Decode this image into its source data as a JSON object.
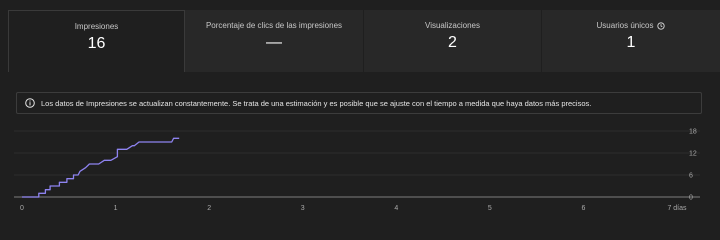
{
  "tabs": [
    {
      "label": "Impresiones",
      "value": "16",
      "active": true
    },
    {
      "label": "Porcentaje de clics de las impresiones",
      "value": "—",
      "active": false
    },
    {
      "label": "Visualizaciones",
      "value": "2",
      "active": false
    },
    {
      "label": "Usuarios únicos",
      "value": "1",
      "active": false,
      "icon": "clock-icon"
    }
  ],
  "banner": {
    "icon": "info-icon",
    "text": "Los datos de Impresiones se actualizan constantemente. Se trata de una estimación y es posible que se ajuste con el tiempo a medida que haya datos más precisos."
  },
  "colors": {
    "background": "#1f1f1f",
    "tab_inactive": "#282828",
    "line": "#8e83f0",
    "grid": "#3a3a3a"
  },
  "chart_data": {
    "type": "line",
    "x_ticks": [
      "0",
      "1",
      "2",
      "3",
      "4",
      "5",
      "6",
      "7 días"
    ],
    "y_ticks": [
      "0",
      "6",
      "12",
      "18"
    ],
    "xlim": [
      0,
      7
    ],
    "ylim": [
      0,
      18
    ],
    "series": [
      {
        "x": [
          0,
          0.18,
          0.18,
          0.25,
          0.25,
          0.3,
          0.3,
          0.4,
          0.4,
          0.48,
          0.48,
          0.55,
          0.55,
          0.6,
          0.62,
          0.68,
          0.72,
          0.78,
          0.82,
          0.88,
          0.95,
          0.95,
          1.02,
          1.02,
          1.1,
          1.12,
          1.18,
          1.2,
          1.25,
          1.3,
          1.6,
          1.62,
          1.68
        ],
        "y": [
          0,
          0,
          1,
          1,
          2,
          2,
          3,
          3,
          4,
          4,
          5,
          5,
          6,
          6,
          7,
          8,
          9,
          9,
          9,
          10,
          10,
          10,
          11,
          13,
          13,
          13,
          14,
          14,
          15,
          15,
          15,
          16,
          16
        ]
      }
    ]
  }
}
